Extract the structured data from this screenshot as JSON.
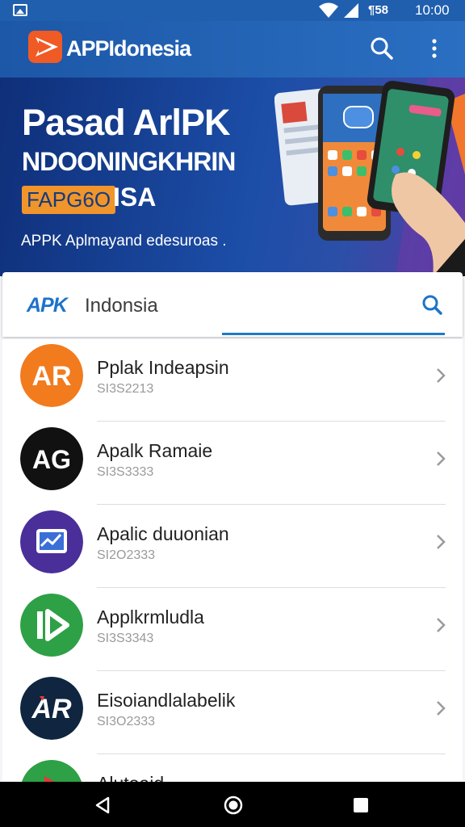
{
  "status_bar": {
    "battery_text": "¶58",
    "time": "10:00"
  },
  "app_bar": {
    "title": "APPIdonesia",
    "logo_icon": "play-arrow-logo",
    "search_icon": "search-icon",
    "menu_icon": "more-vert-icon"
  },
  "banner": {
    "line1": "Pasad ArlPK",
    "line2": "NDOONINGKHRIN",
    "badge": "FAPG6O",
    "badge_after": "ISA",
    "subtitle": "APPK Aplmayand edesuroas ."
  },
  "search_card": {
    "brand_apk": "APK",
    "brand_rest": " Indonsia",
    "search_icon": "search-icon"
  },
  "apps": [
    {
      "name": "Pplak Indeapsin",
      "sub": "SI3S2213",
      "icon": "AR",
      "color": "#f27b1e"
    },
    {
      "name": "Apalk Ramaie",
      "sub": "SI3S3333",
      "icon": "AG",
      "color": "#111111"
    },
    {
      "name": "Apalic duuonian",
      "sub": "SI2O2333",
      "icon": "trend-chart-icon",
      "color": "#4a2f9a"
    },
    {
      "name": "Applkrmludla",
      "sub": "SI3S3343",
      "icon": "play-icon",
      "color": "#2ea046"
    },
    {
      "name": "Eisoiandlalabelik",
      "sub": "SI3O2333",
      "icon": "AR",
      "color": "#0f2540"
    },
    {
      "name": "Alutoaid",
      "sub": "",
      "icon": "music-icon",
      "color": "#2ea046"
    }
  ],
  "nav": {
    "back_icon": "back-icon",
    "home_icon": "home-icon",
    "recents_icon": "recents-icon"
  }
}
